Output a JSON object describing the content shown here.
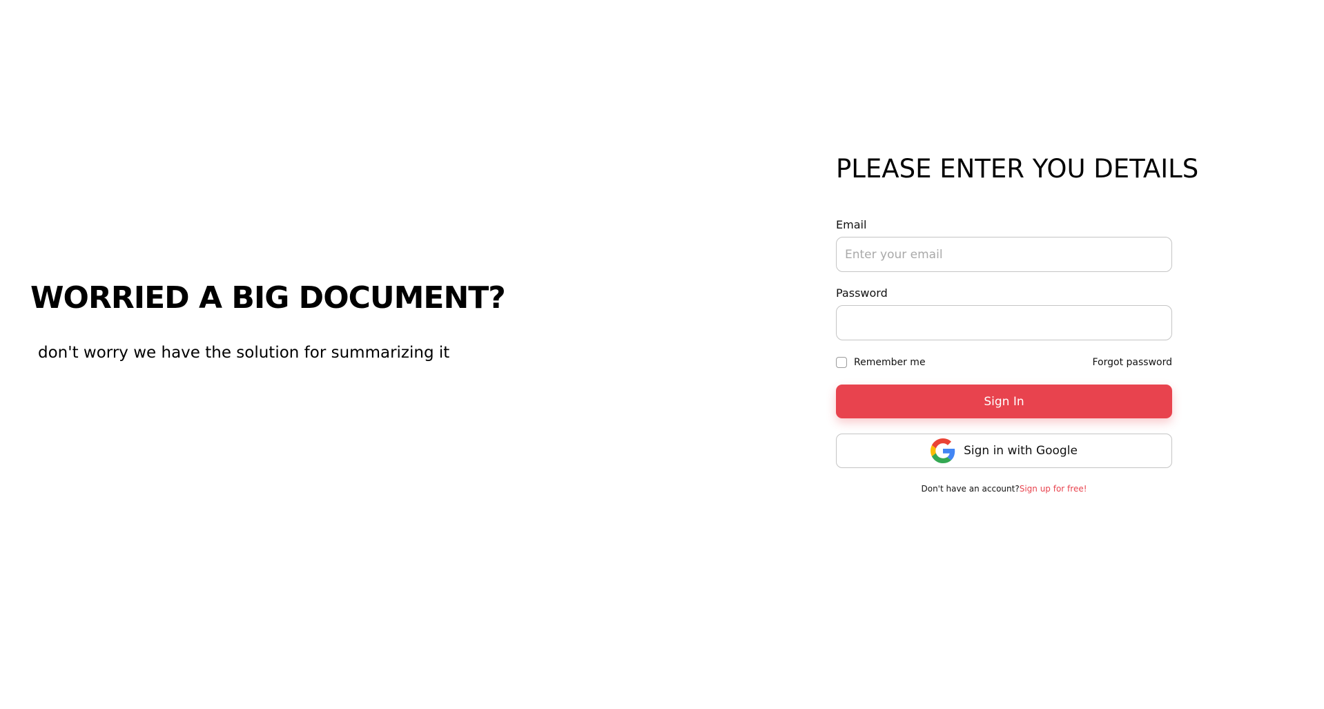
{
  "hero": {
    "title": "WORRIED A BIG DOCUMENT?",
    "subtitle": "don't worry we have the solution for summarizing it"
  },
  "form": {
    "heading": "PLEASE ENTER YOU DETAILS",
    "email_label": "Email",
    "email_placeholder": "Enter your email",
    "email_value": "",
    "password_label": "Password",
    "password_value": "",
    "remember_label": "Remember me",
    "remember_checked": false,
    "forgot_label": "Forgot password",
    "signin_label": "Sign In",
    "google_label": "Sign in with Google",
    "signup_prompt": "Don't have an account?",
    "signup_link": "Sign up for free!"
  },
  "icons": {
    "checkbox": "checkbox-unchecked-icon",
    "google": "google-g-icon"
  },
  "colors": {
    "accent": "#e8434e",
    "border": "#c4c4c4",
    "placeholder": "#a9a9a9",
    "google_blue": "#4285F4",
    "google_red": "#EA4335",
    "google_yellow": "#FBBC05",
    "google_green": "#34A853"
  }
}
